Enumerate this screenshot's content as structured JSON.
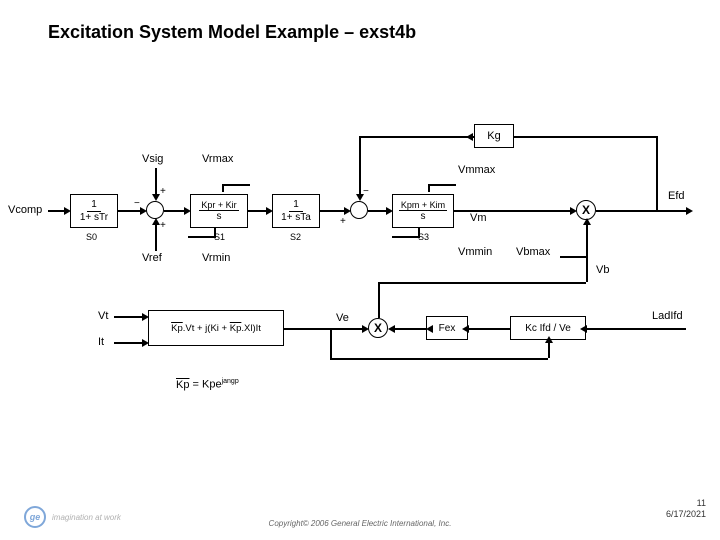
{
  "title": "Excitation System Model Example – exst4b",
  "labels": {
    "vcomp": "Vcomp",
    "vsig": "Vsig",
    "vref": "Vref",
    "vrmax": "Vrmax",
    "vrmin": "Vrmin",
    "vmmax": "Vmmax",
    "vmmin": "Vmmin",
    "vm": "Vm",
    "vbmax": "Vbmax",
    "vb": "Vb",
    "efd": "Efd",
    "vt": "Vt",
    "it": "It",
    "ve": "Ve",
    "ladIfd": "LadIfd",
    "s0": "S0",
    "s1": "S1",
    "s2": "S2",
    "s3": "S3"
  },
  "blocks": {
    "tr_num": "1",
    "tr_den": "1+ sTr",
    "pi1": "Kpr + Kir",
    "ta_num": "1",
    "ta_den": "1+ sTa",
    "pi2": "Kpm + Kim",
    "kg": "Kg",
    "fex": "Fex",
    "kc": "Kc Ifd / Ve",
    "vtit": "Kp.Vt + j(Ki + Kp.Xl)It",
    "kp_eq": "Kp = Kpe"
  },
  "exp": {
    "jangp": "jangp",
    "s": "s"
  },
  "signs": {
    "p": "+",
    "m": "−"
  },
  "mult": "X",
  "footer": {
    "tagline": "imagination at work",
    "copyright": "Copyright© 2006 General Electric International, Inc.",
    "page": "11",
    "date": "6/17/2021",
    "logo": "ge"
  }
}
